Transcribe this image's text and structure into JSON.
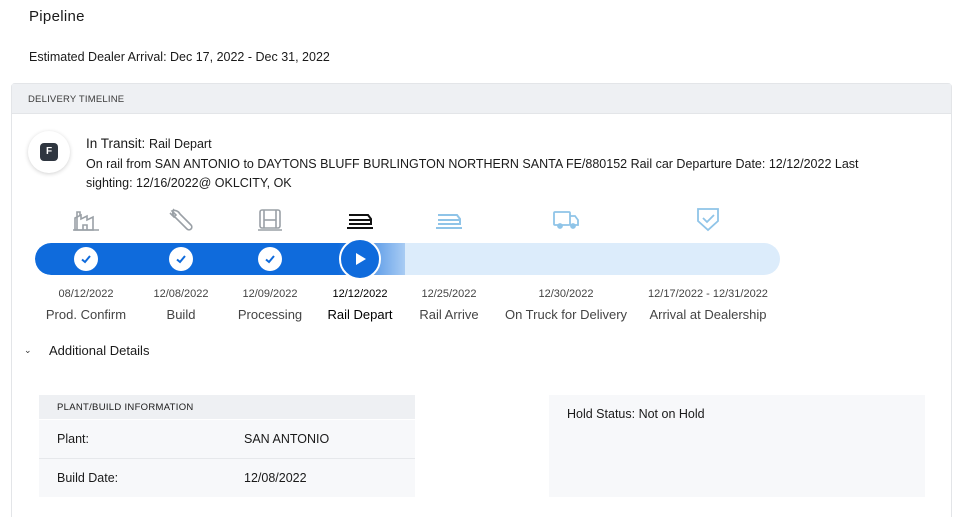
{
  "page": {
    "title": "Pipeline",
    "eta": "Estimated Dealer Arrival: Dec 17, 2022 - Dec 31, 2022"
  },
  "timeline": {
    "header": "DELIVERY TIMELINE",
    "badge_letter": "F",
    "status_label": "In Transit:",
    "status_value": "Rail Depart",
    "description": "On rail from SAN ANTONIO to DAYTONS BLUFF BURLINGTON NORTHERN SANTA FE/880152 Rail car Departure Date: 12/12/2022 Last sighting: 12/16/2022@ OKLCITY, OK",
    "progress_stage_index": 3,
    "stages": [
      {
        "name": "Prod. Confirm",
        "date": "08/12/2022",
        "icon": "factory-icon",
        "state": "complete"
      },
      {
        "name": "Build",
        "date": "12/08/2022",
        "icon": "wrench-icon",
        "state": "complete"
      },
      {
        "name": "Processing",
        "date": "12/09/2022",
        "icon": "car-seat-icon",
        "state": "complete"
      },
      {
        "name": "Rail Depart",
        "date": "12/12/2022",
        "icon": "rail-icon",
        "state": "current"
      },
      {
        "name": "Rail Arrive",
        "date": "12/25/2022",
        "icon": "rail-icon",
        "state": "pending"
      },
      {
        "name": "On Truck for Delivery",
        "date": "12/30/2022",
        "icon": "truck-icon",
        "state": "pending"
      },
      {
        "name": "Arrival at Dealership",
        "date": "12/17/2022 - 12/31/2022",
        "icon": "shield-check-icon",
        "state": "pending"
      }
    ]
  },
  "additional": {
    "toggle_label": "Additional Details",
    "plant_info": {
      "header": "PLANT/BUILD INFORMATION",
      "rows": [
        {
          "label": "Plant:",
          "value": "SAN ANTONIO"
        },
        {
          "label": "Build Date:",
          "value": "12/08/2022"
        }
      ]
    },
    "hold_status": "Hold Status: Not on Hold"
  },
  "colors": {
    "accent": "#0f6bdc",
    "track": "#dcecfb",
    "pending_icon": "#8fc4e8",
    "complete_icon": "#9aa0a6"
  }
}
